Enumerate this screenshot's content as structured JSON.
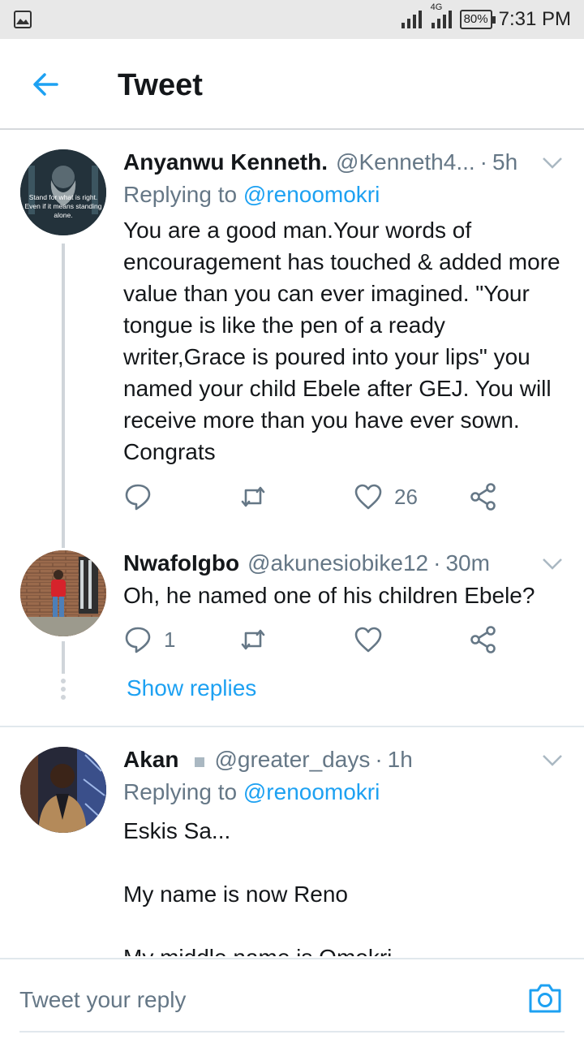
{
  "status_bar": {
    "battery": "80%",
    "time": "7:31 PM",
    "network": "4G"
  },
  "header": {
    "title": "Tweet"
  },
  "tweets": [
    {
      "name": "Anyanwu Kenneth.",
      "handle": "@Kenneth4...",
      "time": "5h",
      "replying_prefix": "Replying to",
      "replying_handle": "@renoomokri",
      "text": "You are a good man.Your words of encouragement has touched & added more value than you can ever imagined. \"Your tongue is like the pen of a ready writer,Grace is poured into your lips\" you named your child Ebele after GEJ. You will receive more than you have ever sown. Congrats",
      "avatar_caption": "Stand for what is right. Even if it means standing alone.",
      "reply_count": "",
      "retweet_count": "",
      "like_count": "26"
    },
    {
      "name": "NwafoIgbo",
      "handle": "@akunesiobike12",
      "time": "30m",
      "text": "Oh, he named one of his children Ebele?",
      "reply_count": "1",
      "retweet_count": "",
      "like_count": ""
    },
    {
      "name": "Akan",
      "handle": "@greater_days",
      "time": "1h",
      "replying_prefix": "Replying to",
      "replying_handle": "@renoomokri",
      "text": "Eskis Sa...\n\nMy name is now Reno\n\nMy middle name is Omokri"
    }
  ],
  "show_replies": "Show replies",
  "reply_bar": {
    "placeholder": "Tweet your reply"
  },
  "colors": {
    "accent": "#1da1f2",
    "secondary_text": "#657786",
    "primary_text": "#14171a"
  }
}
